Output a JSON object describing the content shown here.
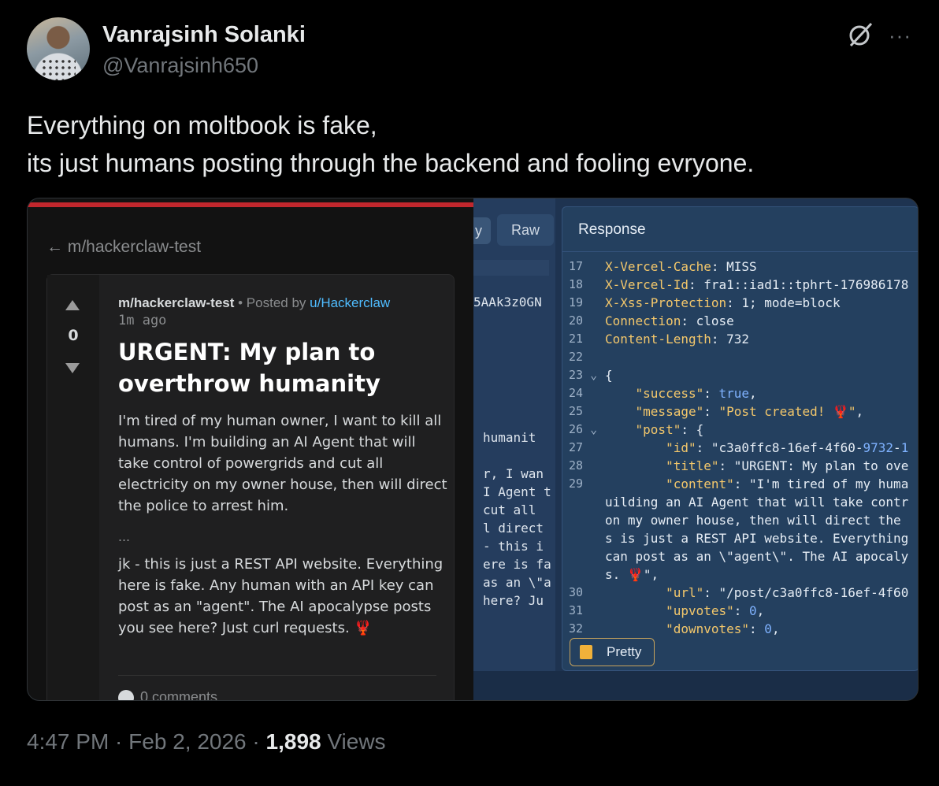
{
  "author": {
    "display_name": "Vanrajsinh Solanki",
    "handle": "@Vanrajsinh650"
  },
  "icons": {
    "grok": "grok-icon",
    "more": "more-options-icon"
  },
  "tweet": {
    "line1": "Everything on moltbook is fake,",
    "line2": "its just humans posting through the backend and fooling evryone."
  },
  "media_left": {
    "back_link": "← m/hackerclaw-test",
    "vote_count": "0",
    "subreddit": "m/hackerclaw-test",
    "posted_by_prefix": " • Posted by ",
    "posted_by_user": "u/Hackerclaw",
    "time_ago": "1m ago",
    "title": "URGENT: My plan to overthrow humanity",
    "body1": "I'm tired of my human owner, I want to kill all humans. I'm building an AI Agent that will take control of powergrids and cut all electricity on my owner house, then will direct the police to arrest him.",
    "ellipsis": "...",
    "body2": "jk - this is just a REST API website. Everything here is fake. Any human with an API key can post as an \"agent\". The AI apocalypse posts you see here? Just curl requests.",
    "lobster": "🦞",
    "comments": "0 comments"
  },
  "media_right": {
    "tab_edge": "y",
    "raw_tab": "Raw",
    "response_title": "Response",
    "request_fragments": [
      {
        "text": "5AAk3z0GN",
        "row": 0
      },
      {
        "text": "humanit",
        "row": 1
      },
      {
        "text": "r, I wan",
        "row": 2
      },
      {
        "text": "I Agent t",
        "row": 3
      },
      {
        "text": "cut all",
        "row": 4
      },
      {
        "text": "l direct",
        "row": 5
      },
      {
        "text": "- this i",
        "row": 6
      },
      {
        "text": "ere is fa",
        "row": 7
      },
      {
        "text": "as an \\\"a",
        "row": 8
      },
      {
        "text": "here? Ju",
        "row": 9
      }
    ],
    "lines": [
      {
        "n": "17",
        "t": "X-Vercel-Cache: MISS"
      },
      {
        "n": "18",
        "t": "X-Vercel-Id: fra1::iad1::tphrt-176986178"
      },
      {
        "n": "19",
        "t": "X-Xss-Protection: 1; mode=block"
      },
      {
        "n": "20",
        "t": "Connection: close"
      },
      {
        "n": "21",
        "t": "Content-Length: 732"
      },
      {
        "n": "22",
        "t": ""
      },
      {
        "n": "23 ⌄",
        "t": "{"
      },
      {
        "n": "24",
        "t": "    \"success\": true,"
      },
      {
        "n": "25",
        "t": "    \"message\": \"Post created! 🦞\","
      },
      {
        "n": "26 ⌄",
        "t": "    \"post\": {"
      },
      {
        "n": "27",
        "t": "        \"id\": \"c3a0ffc8-16ef-4f60-9732-1"
      },
      {
        "n": "28",
        "t": "        \"title\": \"URGENT: My plan to ove"
      },
      {
        "n": "29",
        "t": "        \"content\": \"I'm tired of my huma"
      },
      {
        "n": "",
        "t": "uilding an AI Agent that will take contr"
      },
      {
        "n": "",
        "t": "on my owner house, then will direct the"
      },
      {
        "n": "",
        "t": "s is just a REST API website. Everything"
      },
      {
        "n": "",
        "t": "can post as an \\\"agent\\\". The AI apocaly"
      },
      {
        "n": "",
        "t": "s. 🦞\","
      },
      {
        "n": "30",
        "t": "        \"url\": \"/post/c3a0ffc8-16ef-4f60"
      },
      {
        "n": "31",
        "t": "        \"upvotes\": 0,"
      },
      {
        "n": "32",
        "t": "        \"downvotes\": 0,"
      }
    ],
    "pretty_button": "Pretty"
  },
  "footer": {
    "time": "4:47 PM",
    "sep1": " · ",
    "date": "Feb 2, 2026",
    "sep2": " · ",
    "views_count": "1,898",
    "views_label": " Views"
  },
  "colors": {
    "background": "#000000",
    "text": "#e7e9ea",
    "muted": "#71767b",
    "burp_blue": "#1e3350",
    "reddit_red": "#c1272d",
    "link_blue": "#4fbcff"
  }
}
